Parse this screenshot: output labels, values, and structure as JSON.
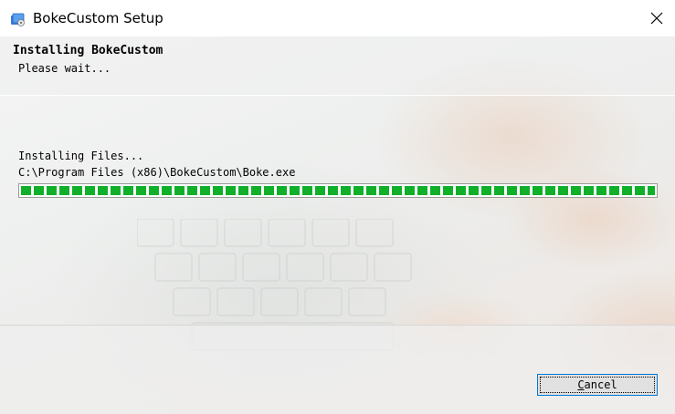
{
  "window": {
    "title": "BokeCustom Setup",
    "close_symbol": "✕"
  },
  "header": {
    "title": "Installing BokeCustom",
    "subtitle": "Please wait..."
  },
  "status": {
    "label": "Installing Files...",
    "current_file": "C:\\Program Files (x86)\\BokeCustom\\Boke.exe"
  },
  "progress": {
    "fraction": 1.0,
    "color": "#10b02a"
  },
  "buttons": {
    "cancel_mnemonic": "C",
    "cancel_rest": "ancel"
  },
  "icons": {
    "app": "setup-installer-icon",
    "close": "close-icon"
  }
}
